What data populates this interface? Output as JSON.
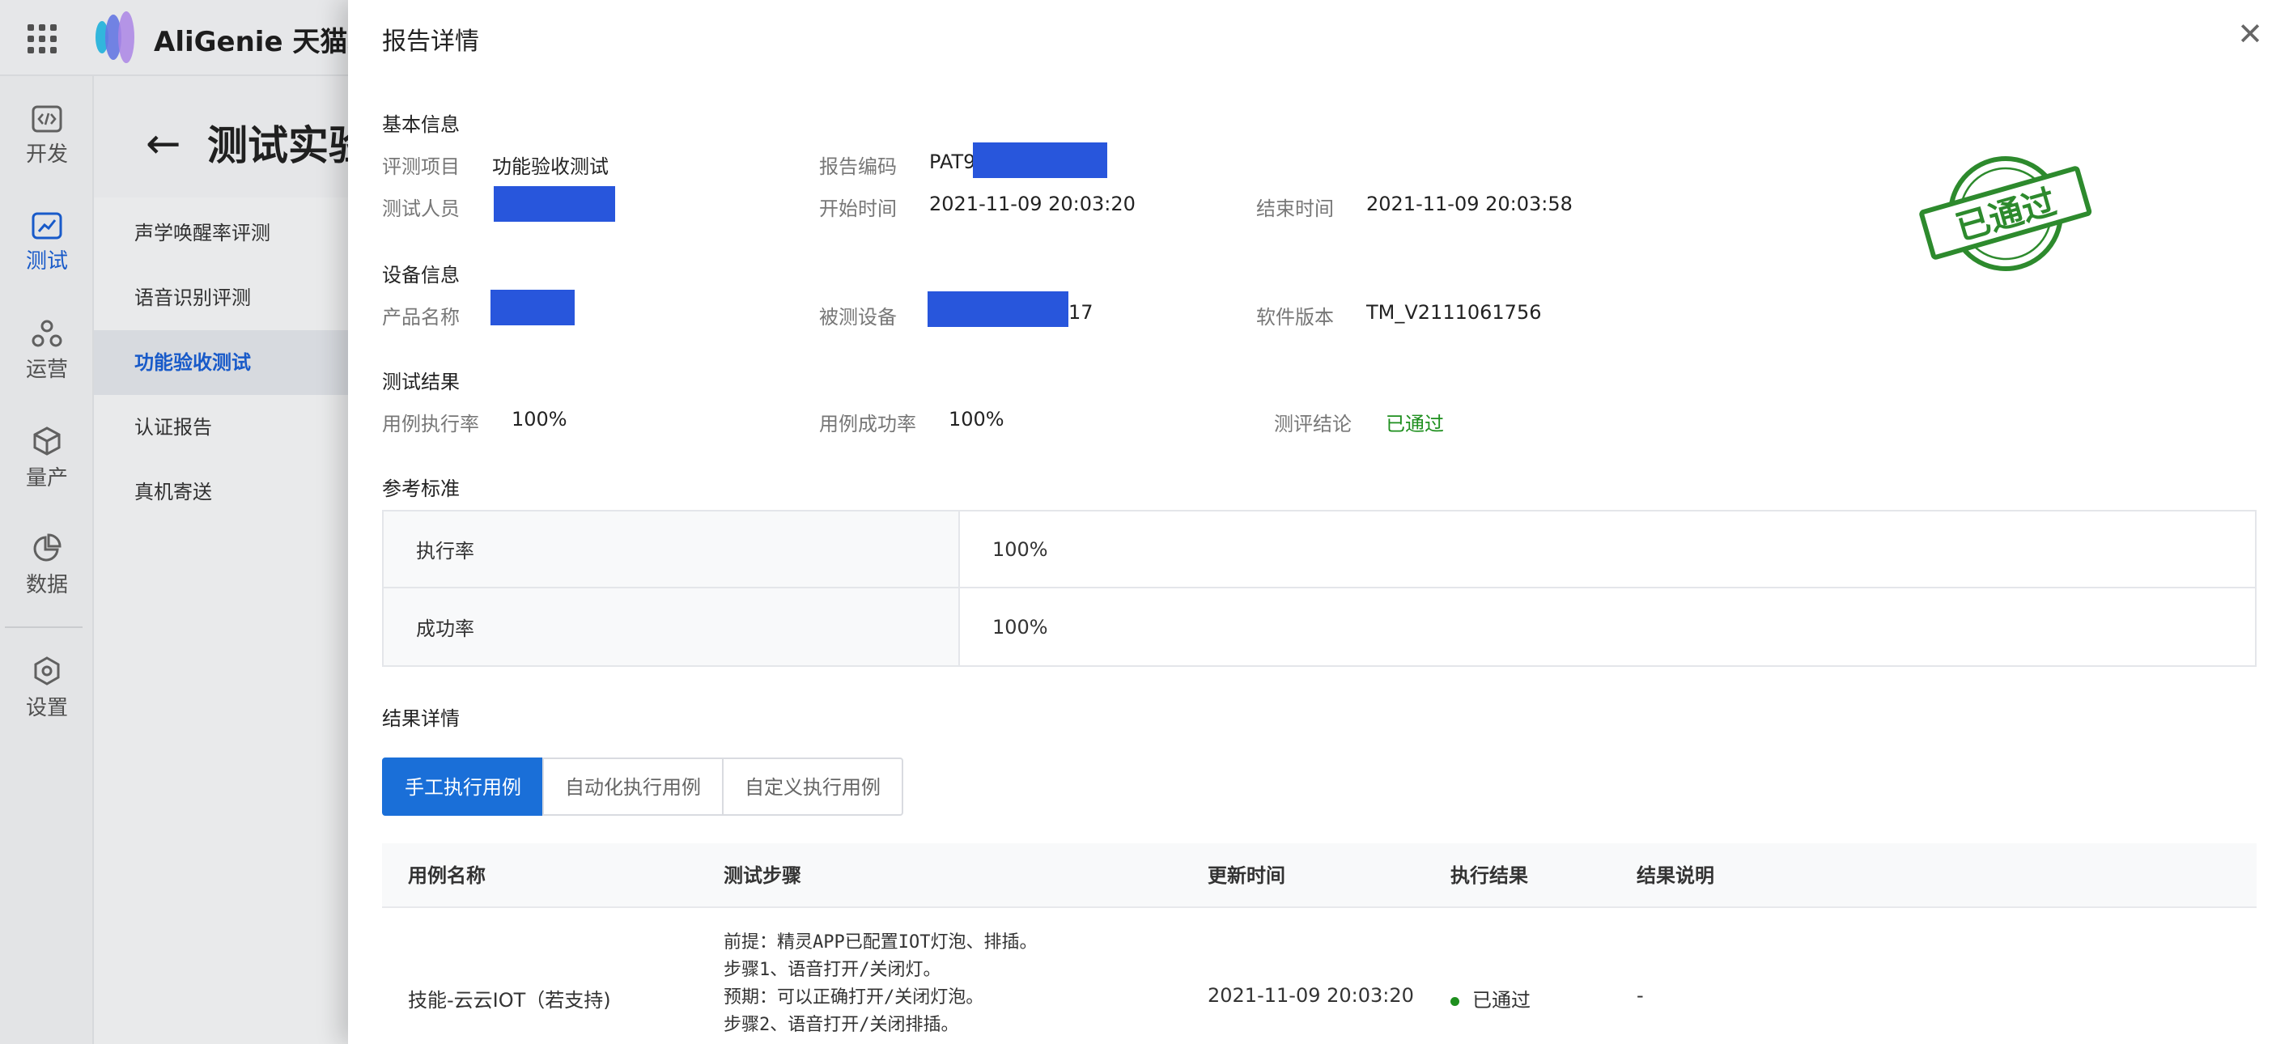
{
  "app": {
    "brand": "AliGenie 天猫精灵",
    "page_title": "测试实验",
    "left_nav": [
      {
        "label": "开发",
        "icon": "code-icon",
        "active": false
      },
      {
        "label": "测试",
        "icon": "chart-icon",
        "active": true
      },
      {
        "label": "运营",
        "icon": "circles-icon",
        "active": false
      },
      {
        "label": "量产",
        "icon": "box-icon",
        "active": false
      },
      {
        "label": "数据",
        "icon": "pie-icon",
        "active": false
      },
      {
        "label": "设置",
        "icon": "gear-icon",
        "active": false
      }
    ],
    "sub_nav": [
      {
        "label": "声学唤醒率评测",
        "active": false
      },
      {
        "label": "语音识别评测",
        "active": false
      },
      {
        "label": "功能验收测试",
        "active": true
      },
      {
        "label": "认证报告",
        "active": false
      },
      {
        "label": "真机寄送",
        "active": false
      }
    ]
  },
  "drawer": {
    "title": "报告详情",
    "stamp_text": "已通过",
    "basic": {
      "heading": "基本信息",
      "project_label": "评测项目",
      "project_value": "功能验收测试",
      "code_label": "报告编码",
      "code_value": "PAT9",
      "tester_label": "测试人员",
      "start_label": "开始时间",
      "start_value": "2021-11-09 20:03:20",
      "end_label": "结束时间",
      "end_value": "2021-11-09 20:03:58"
    },
    "device": {
      "heading": "设备信息",
      "product_label": "产品名称",
      "device_label": "被测设备",
      "device_value_suffix": "17",
      "software_label": "软件版本",
      "software_value": "TM_V2111061756"
    },
    "result": {
      "heading": "测试结果",
      "exec_label": "用例执行率",
      "exec_value": "100%",
      "success_label": "用例成功率",
      "success_value": "100%",
      "conclusion_label": "测评结论",
      "conclusion_value": "已通过"
    },
    "standard": {
      "heading": "参考标准",
      "rows": [
        {
          "key": "执行率",
          "value": "100%"
        },
        {
          "key": "成功率",
          "value": "100%"
        }
      ]
    },
    "details": {
      "heading": "结果详情",
      "tabs": [
        {
          "label": "手工执行用例",
          "active": true
        },
        {
          "label": "自动化执行用例",
          "active": false
        },
        {
          "label": "自定义执行用例",
          "active": false
        }
      ],
      "columns": [
        "用例名称",
        "测试步骤",
        "更新时间",
        "执行结果",
        "结果说明"
      ],
      "rows": [
        {
          "name": "技能-云云IOT（若支持)",
          "steps": [
            "前提：精灵APP已配置IOT灯泡、排插。",
            "步骤1、语音打开/关闭灯。",
            "预期：可以正确打开/关闭灯泡。",
            "步骤2、语音打开/关闭排插。"
          ],
          "updated": "2021-11-09 20:03:20",
          "result": "已通过",
          "note": "-"
        }
      ]
    }
  },
  "colors": {
    "accent": "#1a6fd8",
    "pass": "#1e8f1e",
    "redaction": "#2856dc"
  }
}
